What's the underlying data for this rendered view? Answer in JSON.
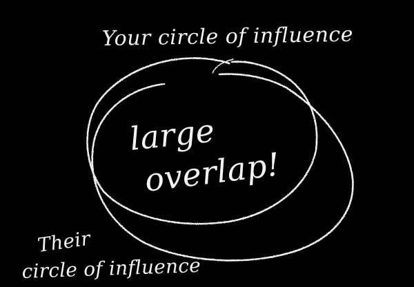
{
  "labels": {
    "your_circle": "Your circle of influence",
    "large_overlap_line1": "large",
    "large_overlap_line2": "overlap!",
    "their_circle_line1": "Their",
    "their_circle_line2": "circle of influence"
  },
  "colors": {
    "background": "#000000",
    "chalk": "#f0f0f0"
  }
}
